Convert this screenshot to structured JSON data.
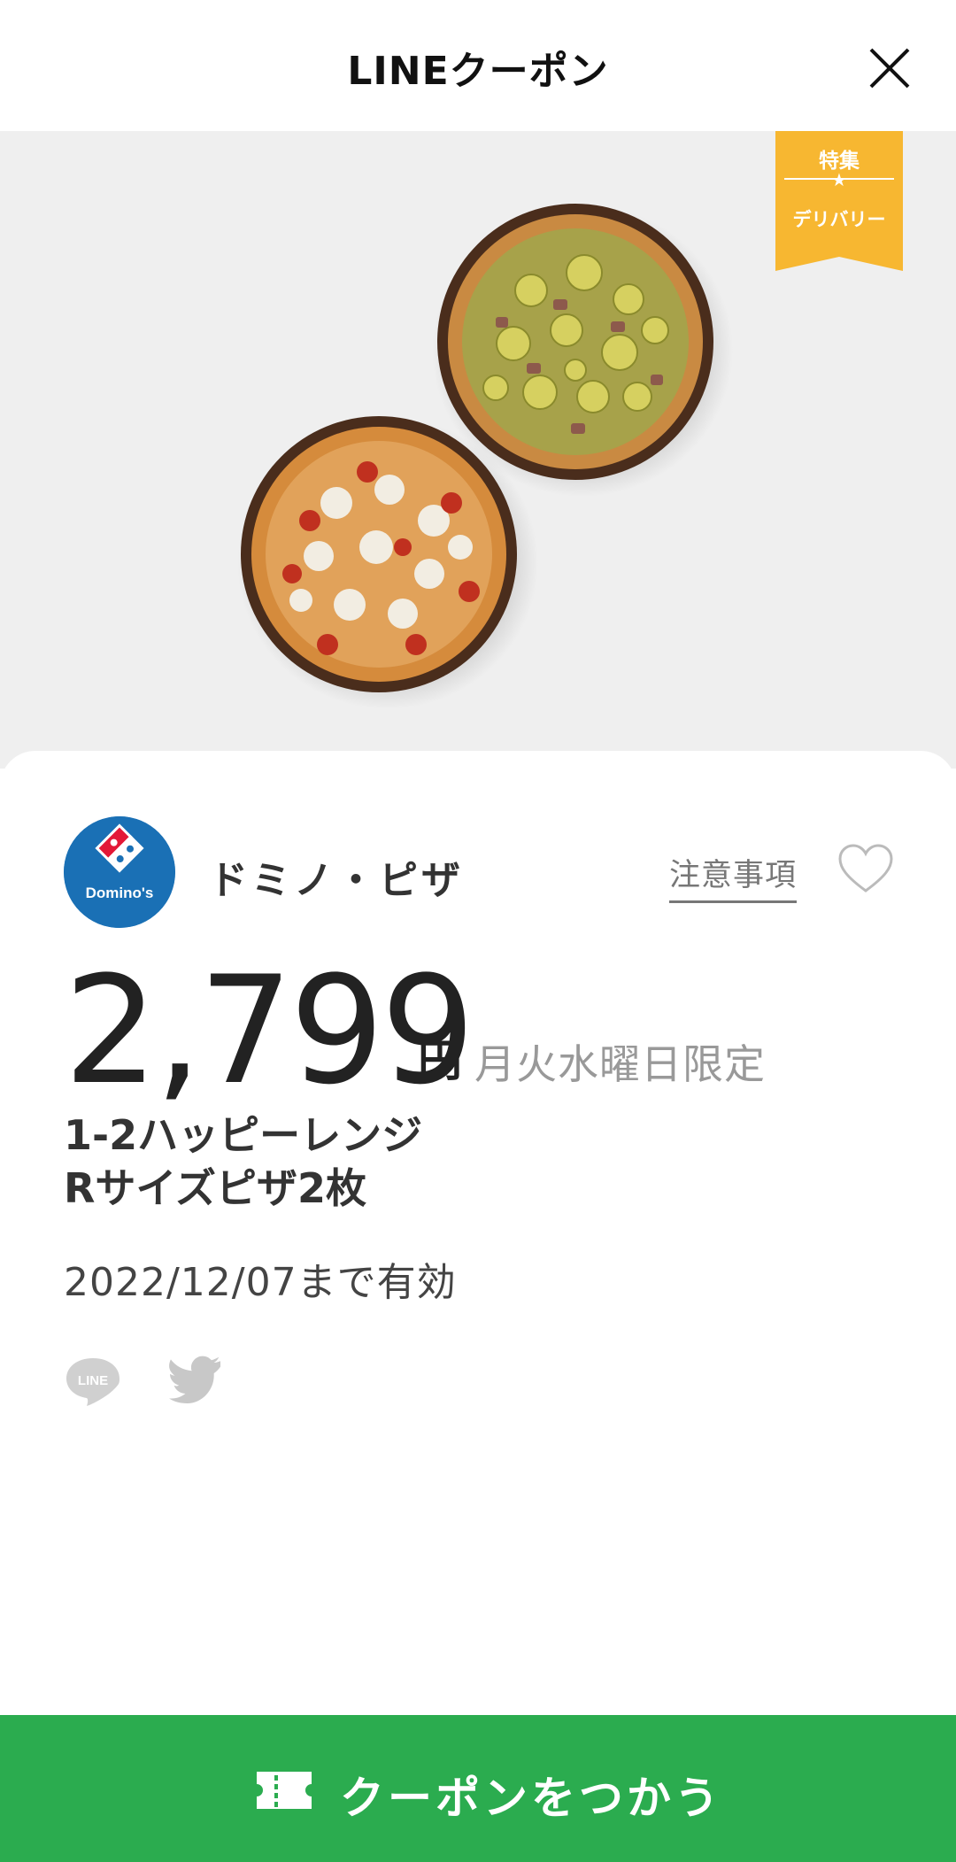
{
  "header": {
    "title": "LINEクーポン",
    "close_icon": "close-icon"
  },
  "badge": {
    "top": "特集",
    "star": "★",
    "bottom": "デリバリー",
    "color": "#f7b731"
  },
  "store": {
    "name": "ドミノ・ピザ",
    "logo_text": "Domino's",
    "notes_label": "注意事項",
    "favorite_icon": "heart-outline-icon"
  },
  "offer": {
    "price": "2,799",
    "currency": "円",
    "limit_label": "月火水曜日限定",
    "title_line1": "1-2ハッピーレンジ",
    "title_line2": "Rサイズピザ2枚",
    "validity": "2022/12/07まで有効"
  },
  "share": {
    "line_icon": "line-share-icon",
    "line_text": "LINE",
    "twitter_icon": "twitter-icon"
  },
  "footer": {
    "button_label": "クーポンをつかう",
    "icon": "ticket-icon",
    "color": "#2bac4f"
  }
}
